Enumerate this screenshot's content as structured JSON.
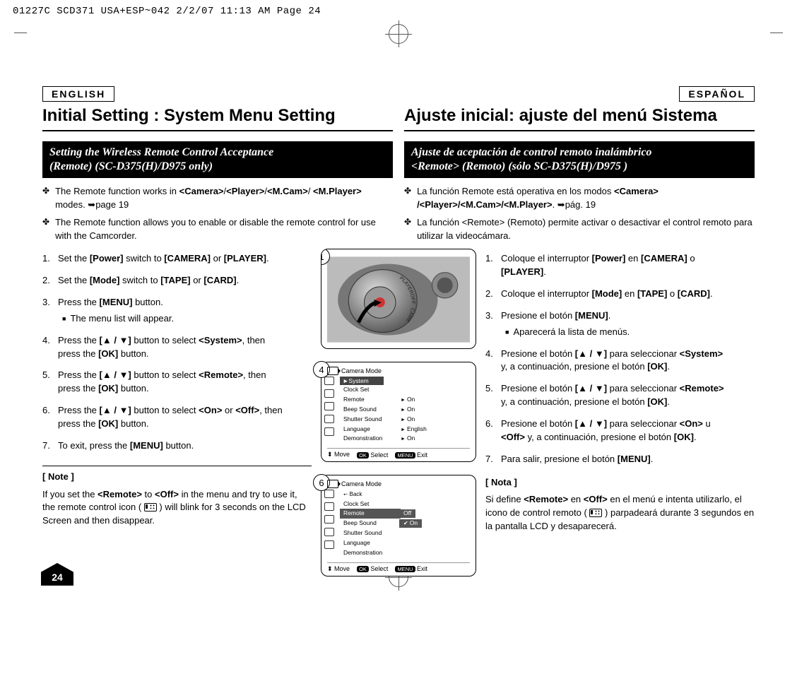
{
  "meta_line": "01227C SCD371 USA+ESP~042  2/2/07 11:13 AM  Page 24",
  "page_number": "24",
  "left": {
    "lang": "ENGLISH",
    "title": "Initial Setting : System Menu Setting",
    "bar_l1": "Setting the Wireless Remote Control Acceptance",
    "bar_l2": "(Remote) (SC-D375(H)/D975 only)",
    "bullets": [
      "The Remote function works in <b>&lt;Camera&gt;</b>/<b>&lt;Player&gt;</b>/<b>&lt;M.Cam&gt;</b>/ <b>&lt;M.Player&gt;</b> modes. ➥page 19",
      "The Remote function allows you to enable or disable the remote control for use with the Camcorder."
    ],
    "steps": [
      "Set the <b>[Power]</b> switch to <b>[CAMERA]</b> or <b>[PLAYER]</b>.",
      "Set the <b>[Mode]</b> switch to <b>[TAPE]</b> or <b>[CARD]</b>.",
      "Press the <b>[MENU]</b> button.<div class='sub-square'>The menu list will appear.</div>",
      "Press the <b>[▲ / ▼]</b> button to select <b>&lt;System&gt;</b>, then press the <b>[OK]</b> button.",
      "Press the <b>[▲ / ▼]</b> button to select <b>&lt;Remote&gt;</b>, then press the <b>[OK]</b> button.",
      "Press the <b>[▲ / ▼]</b> button to select <b>&lt;On&gt;</b> or <b>&lt;Off&gt;</b>, then press the <b>[OK]</b> button.",
      "To exit, press the <b>[MENU]</b> button."
    ],
    "note_head": "[ Note ]",
    "note_body": "If you set the <b>&lt;Remote&gt;</b> to <b>&lt;Off&gt;</b> in the menu and try to use it, the remote control icon (   ) will blink for 3 seconds on the LCD Screen and then disappear."
  },
  "right": {
    "lang": "ESPAÑOL",
    "title": "Ajuste inicial: ajuste del menú Sistema",
    "bar_l1": "Ajuste de aceptación de control remoto inalámbrico",
    "bar_l2": "<Remote> (Remoto) (sólo SC-D375(H)/D975 )",
    "bullets": [
      "La función Remote está operativa en los modos <b>&lt;Camera&gt; /&lt;Player&gt;/&lt;M.Cam&gt;/&lt;M.Player&gt;</b>. ➥pág. 19",
      "La función &lt;Remote&gt; (Remoto) permite activar o desactivar el control remoto para utilizar la videocámara."
    ],
    "steps": [
      "Coloque el interruptor <b>[Power]</b> en <b>[CAMERA]</b> o <b>[PLAYER]</b>.",
      "Coloque el interruptor <b>[Mode]</b>  en <b>[TAPE]</b> o <b>[CARD]</b>.",
      "Presione el botón <b>[MENU]</b>.<div class='sub-square'>Aparecerá la lista de menús.</div>",
      "Presione el botón <b>[▲ / ▼]</b> para seleccionar <b>&lt;System&gt;</b> y, a continuación, presione el botón <b>[OK]</b>.",
      "Presione el botón <b>[▲ / ▼]</b> para seleccionar <b>&lt;Remote&gt;</b> y, a continuación, presione el botón <b>[OK]</b>.",
      "Presione el botón <b>[▲ / ▼]</b> para seleccionar <b>&lt;On&gt;</b> u <b>&lt;Off&gt;</b> y, a continuación, presione el botón <b>[OK]</b>.",
      "Para salir, presione el botón <b>[MENU]</b>."
    ],
    "note_head": "[ Nota ]",
    "note_body": "Si define <b>&lt;Remote&gt;</b> en <b>&lt;Off&gt;</b> en el menú e intenta utilizarlo, el icono de control remoto (   ) parpadeará durante 3 segundos en la pantalla LCD y desaparecerá."
  },
  "illus": {
    "step_1": "1",
    "step_4": "4",
    "step_6": "6",
    "menu4": {
      "title": "Camera Mode",
      "header": "►System",
      "rows": [
        {
          "lbl": "Clock Set",
          "val": ""
        },
        {
          "lbl": "Remote",
          "val": "On"
        },
        {
          "lbl": "Beep Sound",
          "val": "On"
        },
        {
          "lbl": "Shutter Sound",
          "val": "On"
        },
        {
          "lbl": "Language",
          "val": "English"
        },
        {
          "lbl": "Demonstration",
          "val": "On"
        }
      ],
      "foot_move": "Move",
      "foot_select": "Select",
      "foot_exit": "Exit",
      "ok": "OK",
      "menu": "MENU"
    },
    "menu6": {
      "title": "Camera Mode",
      "back": "Back",
      "rows": [
        {
          "lbl": "Clock Set"
        },
        {
          "lbl": "Remote",
          "opt_off": "Off",
          "opt_on": "On"
        },
        {
          "lbl": "Beep Sound"
        },
        {
          "lbl": "Shutter Sound"
        },
        {
          "lbl": "Language"
        },
        {
          "lbl": "Demonstration"
        }
      ],
      "foot_move": "Move",
      "foot_select": "Select",
      "foot_exit": "Exit",
      "ok": "OK",
      "menu": "MENU"
    },
    "dial": {
      "player": "PLAYER",
      "off": "OFF",
      "camera": "CAMERA"
    }
  }
}
